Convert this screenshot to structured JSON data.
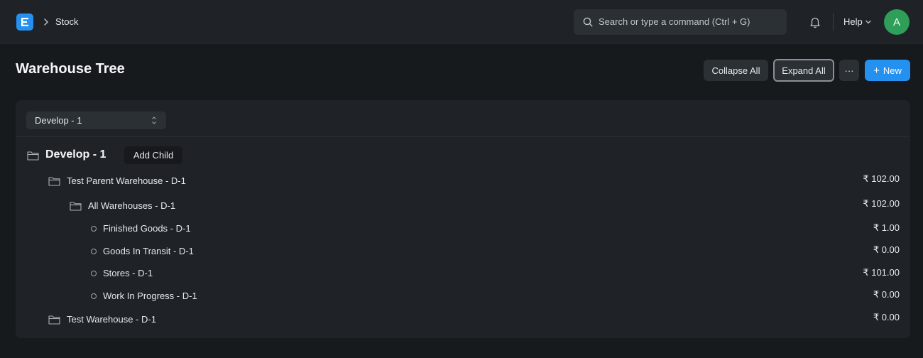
{
  "navbar": {
    "logo_letter": "E",
    "breadcrumb": "Stock",
    "search_placeholder": "Search or type a command (Ctrl + G)",
    "help_label": "Help",
    "avatar_initial": "A"
  },
  "page": {
    "title": "Warehouse Tree",
    "actions": {
      "collapse_all": "Collapse All",
      "expand_all": "Expand All",
      "more": "···",
      "new_plus": "+",
      "new_label": "New"
    }
  },
  "filter": {
    "company_value": "Develop - 1"
  },
  "tree": {
    "root": {
      "label": "Develop - 1",
      "add_child": "Add Child"
    },
    "nodes": [
      {
        "label": "Test Parent Warehouse - D-1",
        "value": "₹ 102.00",
        "type": "folder"
      },
      {
        "label": "All Warehouses - D-1",
        "value": "₹ 102.00",
        "type": "folder"
      },
      {
        "label": "Finished Goods - D-1",
        "value": "₹ 1.00",
        "type": "leaf"
      },
      {
        "label": "Goods In Transit - D-1",
        "value": "₹ 0.00",
        "type": "leaf"
      },
      {
        "label": "Stores - D-1",
        "value": "₹ 101.00",
        "type": "leaf"
      },
      {
        "label": "Work In Progress - D-1",
        "value": "₹ 0.00",
        "type": "leaf"
      },
      {
        "label": "Test Warehouse - D-1",
        "value": "₹ 0.00",
        "type": "folder"
      }
    ]
  },
  "colors": {
    "primary": "#2490ef",
    "avatar": "#2f9e58",
    "background": "#171a1d",
    "surface": "#1f2327"
  }
}
